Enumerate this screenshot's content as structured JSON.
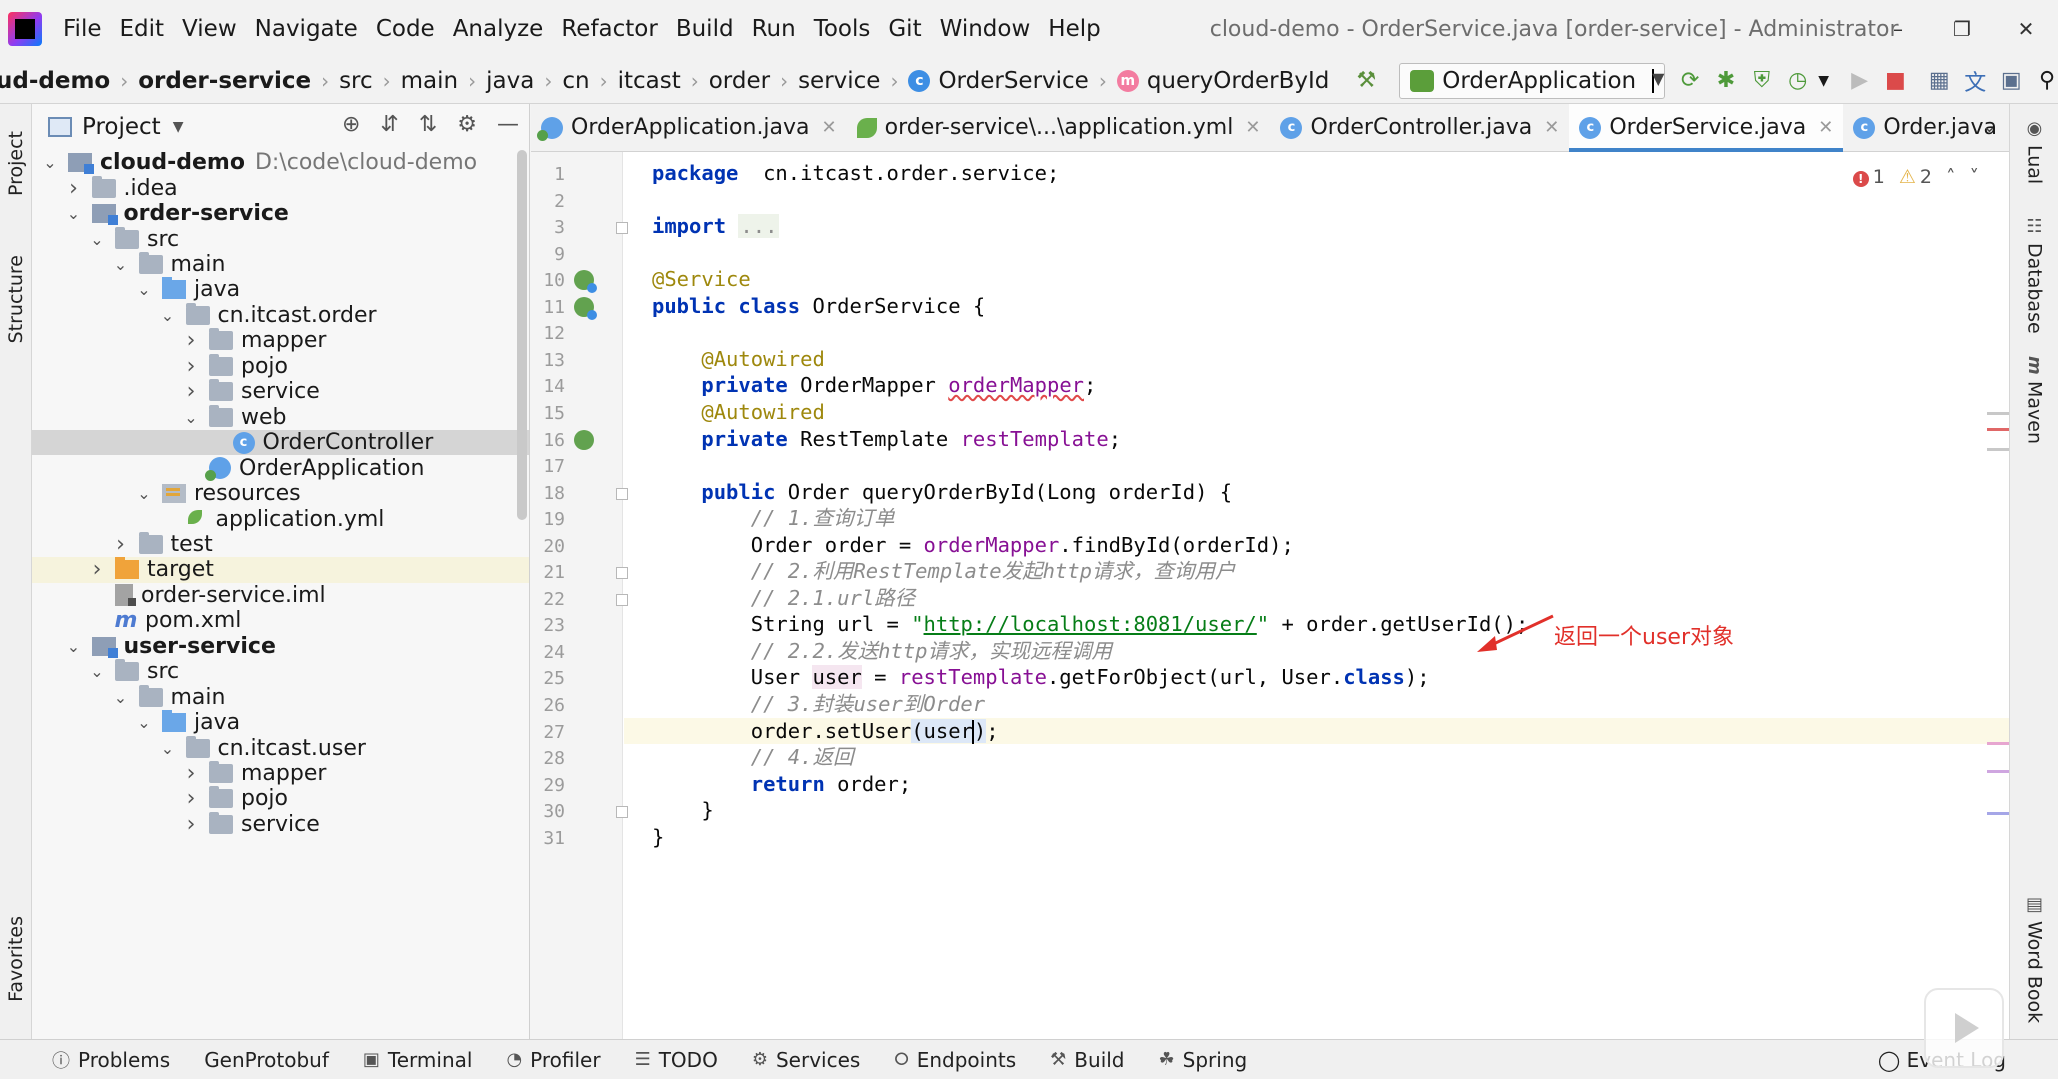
{
  "window": {
    "title": "cloud-demo - OrderService.java [order-service] - Administrator",
    "menu": [
      "File",
      "Edit",
      "View",
      "Navigate",
      "Code",
      "Analyze",
      "Refactor",
      "Build",
      "Run",
      "Tools",
      "Git",
      "Window",
      "Help"
    ],
    "controls": [
      "minimize",
      "restore",
      "close"
    ]
  },
  "navbar": {
    "breadcrumb": [
      "ud-demo",
      "order-service",
      "src",
      "main",
      "java",
      "cn",
      "itcast",
      "order",
      "service",
      "OrderService",
      "queryOrderById"
    ],
    "run_config": "OrderApplication"
  },
  "left_strip": {
    "tabs": [
      "Project",
      "Structure",
      "Favorites"
    ]
  },
  "project": {
    "title": "Project",
    "tree": [
      {
        "label": "cloud-demo",
        "path": "D:\\code\\cloud-demo",
        "icon": "module-icon",
        "depth": 0,
        "expanded": true,
        "bold": true
      },
      {
        "label": ".idea",
        "icon": "folder-icon",
        "depth": 1,
        "expanded": false
      },
      {
        "label": "order-service",
        "icon": "module-icon",
        "depth": 1,
        "expanded": true,
        "bold": true
      },
      {
        "label": "src",
        "icon": "folder-icon",
        "depth": 2,
        "expanded": true
      },
      {
        "label": "main",
        "icon": "folder-icon",
        "depth": 3,
        "expanded": true
      },
      {
        "label": "java",
        "icon": "source-folder-icon",
        "depth": 4,
        "expanded": true
      },
      {
        "label": "cn.itcast.order",
        "icon": "package-icon",
        "depth": 5,
        "expanded": true
      },
      {
        "label": "mapper",
        "icon": "package-icon",
        "depth": 6,
        "expanded": false
      },
      {
        "label": "pojo",
        "icon": "package-icon",
        "depth": 6,
        "expanded": false
      },
      {
        "label": "service",
        "icon": "package-icon",
        "depth": 6,
        "expanded": false
      },
      {
        "label": "web",
        "icon": "package-icon",
        "depth": 6,
        "expanded": true
      },
      {
        "label": "OrderController",
        "icon": "class-icon",
        "depth": 7,
        "selected": true
      },
      {
        "label": "OrderApplication",
        "icon": "spring-app-icon",
        "depth": 6
      },
      {
        "label": "resources",
        "icon": "resources-folder-icon",
        "depth": 4,
        "expanded": true
      },
      {
        "label": "application.yml",
        "icon": "yaml-icon",
        "depth": 5
      },
      {
        "label": "test",
        "icon": "folder-icon",
        "depth": 3,
        "expanded": false
      },
      {
        "label": "target",
        "icon": "excluded-folder-icon",
        "depth": 2,
        "expanded": false,
        "excluded": true
      },
      {
        "label": "order-service.iml",
        "icon": "iml-icon",
        "depth": 2
      },
      {
        "label": "pom.xml",
        "icon": "maven-icon",
        "depth": 2
      },
      {
        "label": "user-service",
        "icon": "module-icon",
        "depth": 1,
        "expanded": true,
        "bold": true
      },
      {
        "label": "src",
        "icon": "folder-icon",
        "depth": 2,
        "expanded": true
      },
      {
        "label": "main",
        "icon": "folder-icon",
        "depth": 3,
        "expanded": true
      },
      {
        "label": "java",
        "icon": "source-folder-icon",
        "depth": 4,
        "expanded": true
      },
      {
        "label": "cn.itcast.user",
        "icon": "package-icon",
        "depth": 5,
        "expanded": true
      },
      {
        "label": "mapper",
        "icon": "package-icon",
        "depth": 6,
        "expanded": false
      },
      {
        "label": "pojo",
        "icon": "package-icon",
        "depth": 6,
        "expanded": false
      },
      {
        "label": "service",
        "icon": "package-icon",
        "depth": 6,
        "expanded": false
      }
    ]
  },
  "tabs": [
    {
      "label": "OrderApplication.java",
      "icon": "spring-app-icon",
      "active": false
    },
    {
      "label": "order-service\\...\\application.yml",
      "icon": "yaml-icon",
      "active": false
    },
    {
      "label": "OrderController.java",
      "icon": "class-icon",
      "active": false
    },
    {
      "label": "OrderService.java",
      "icon": "class-icon",
      "active": true
    },
    {
      "label": "Order.java",
      "icon": "class-icon",
      "active": false
    }
  ],
  "inspection": {
    "errors": "1",
    "warnings": "2"
  },
  "code": {
    "lines": [
      {
        "n": "1",
        "tokens": [
          [
            "kw",
            "package"
          ],
          [
            "",
            "  cn.itcast.order.service;"
          ]
        ]
      },
      {
        "n": "2",
        "tokens": []
      },
      {
        "n": "3",
        "tokens": [
          [
            "kw",
            "import"
          ],
          [
            "",
            " "
          ],
          [
            "fold",
            "..."
          ]
        ]
      },
      {
        "n": "9",
        "tokens": []
      },
      {
        "n": "10",
        "tokens": [
          [
            "an",
            "@Service"
          ]
        ]
      },
      {
        "n": "11",
        "tokens": [
          [
            "kw",
            "public class"
          ],
          [
            "",
            " OrderService {"
          ]
        ]
      },
      {
        "n": "12",
        "tokens": []
      },
      {
        "n": "13",
        "tokens": [
          [
            "",
            "    "
          ],
          [
            "an",
            "@Autowired"
          ]
        ]
      },
      {
        "n": "14",
        "tokens": [
          [
            "",
            "    "
          ],
          [
            "kw",
            "private"
          ],
          [
            "",
            " OrderMapper "
          ],
          [
            "fld-sq",
            "orderMapper"
          ],
          [
            "",
            ";"
          ]
        ]
      },
      {
        "n": "15",
        "tokens": [
          [
            "",
            "    "
          ],
          [
            "an",
            "@Autowired"
          ]
        ]
      },
      {
        "n": "16",
        "tokens": [
          [
            "",
            "    "
          ],
          [
            "kw",
            "private"
          ],
          [
            "",
            " RestTemplate "
          ],
          [
            "fld",
            "restTemplate"
          ],
          [
            "",
            ";"
          ]
        ]
      },
      {
        "n": "17",
        "tokens": []
      },
      {
        "n": "18",
        "tokens": [
          [
            "",
            "    "
          ],
          [
            "kw",
            "public"
          ],
          [
            "",
            " Order queryOrderById(Long orderId) {"
          ]
        ]
      },
      {
        "n": "19",
        "tokens": [
          [
            "",
            "        "
          ],
          [
            "cmt",
            "// 1.查询订单"
          ]
        ]
      },
      {
        "n": "20",
        "tokens": [
          [
            "",
            "        Order order = "
          ],
          [
            "fld",
            "orderMapper"
          ],
          [
            "",
            ".findById(orderId);"
          ]
        ]
      },
      {
        "n": "21",
        "tokens": [
          [
            "",
            "        "
          ],
          [
            "cmt",
            "// 2.利用RestTemplate发起http请求，查询用户"
          ]
        ]
      },
      {
        "n": "22",
        "tokens": [
          [
            "",
            "        "
          ],
          [
            "cmt",
            "// 2.1.url路径"
          ]
        ]
      },
      {
        "n": "23",
        "tokens": [
          [
            "",
            "        String url = "
          ],
          [
            "str",
            "\""
          ],
          [
            "url",
            "http://localhost:8081/user/"
          ],
          [
            "str",
            "\""
          ],
          [
            "",
            " + order.getUserId();"
          ]
        ]
      },
      {
        "n": "24",
        "tokens": [
          [
            "",
            "        "
          ],
          [
            "cmt",
            "// 2.2.发送http请求，实现远程调用"
          ]
        ]
      },
      {
        "n": "25",
        "tokens": [
          [
            "",
            "        User "
          ],
          [
            "var",
            "user"
          ],
          [
            "",
            " = "
          ],
          [
            "fld",
            "restTemplate"
          ],
          [
            "",
            ".getForObject(url, User."
          ],
          [
            "kw",
            "class"
          ],
          [
            "",
            ");"
          ]
        ]
      },
      {
        "n": "26",
        "tokens": [
          [
            "",
            "        "
          ],
          [
            "cmt",
            "// 3.封装user到Order"
          ]
        ]
      },
      {
        "n": "27",
        "tokens": [
          [
            "",
            "        order.setUser"
          ],
          [
            "par",
            "(user"
          ],
          [
            "caret",
            ""
          ],
          [
            "par",
            ")"
          ],
          [
            "",
            ";"
          ]
        ],
        "current": true
      },
      {
        "n": "28",
        "tokens": [
          [
            "",
            "        "
          ],
          [
            "cmt",
            "// 4.返回"
          ]
        ]
      },
      {
        "n": "29",
        "tokens": [
          [
            "",
            "        "
          ],
          [
            "kw",
            "return"
          ],
          [
            "",
            " order;"
          ]
        ]
      },
      {
        "n": "30",
        "tokens": [
          [
            "",
            "    }"
          ]
        ]
      },
      {
        "n": "31",
        "tokens": [
          [
            "",
            "}"
          ]
        ]
      }
    ]
  },
  "annotation": {
    "text": "返回一个user对象",
    "color": "#e1302a"
  },
  "right_strip": {
    "tabs": [
      "Lual",
      "Database",
      "Maven",
      "Word Book"
    ]
  },
  "bottom": {
    "tools": [
      "Problems",
      "GenProtobuf",
      "Terminal",
      "Profiler",
      "TODO",
      "Services",
      "Endpoints",
      "Build",
      "Spring"
    ],
    "event_log": "Event Log"
  },
  "colors": {
    "keyword": "#0033b3",
    "annotation": "#9e880d",
    "field": "#871094",
    "string": "#067d17",
    "comment": "#8c8c8c",
    "accent": "#4083c9"
  }
}
